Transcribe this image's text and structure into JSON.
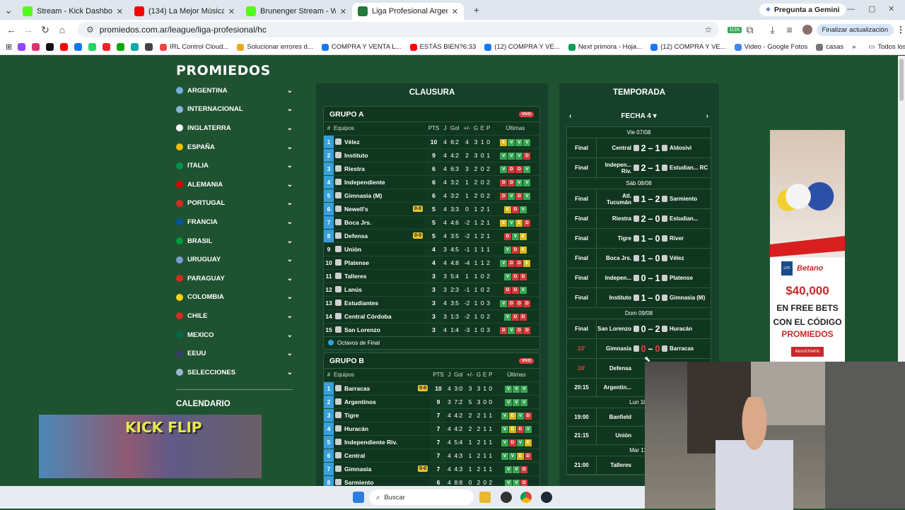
{
  "browser": {
    "tabs": [
      {
        "title": "Stream - Kick Dashboard",
        "color": "#53fc18"
      },
      {
        "title": "(134) La Mejor Música Clás",
        "color": "#ff0000"
      },
      {
        "title": "Brunenger Stream - Watch Live",
        "color": "#53fc18"
      },
      {
        "title": "Liga Profesional Argentina - PC",
        "color": "#1f7a3c"
      }
    ],
    "gemini": "Pregunta a Gemini",
    "url": "promiedos.com.ar/league/liga-profesional/hc",
    "update": "Finalizar actualización",
    "badge_count": "111K",
    "bookmarks": [
      "IRL Control Cloud...",
      "Solucionar errores d...",
      "COMPRA Y VENTA L...",
      "ESTÁS BIEN?6:33",
      "(12) COMPRA Y VE...",
      "Next primora - Hoja...",
      "(12) COMPRA Y VE...",
      "Video - Google Fotos",
      "casas"
    ],
    "all_bookmarks": "Todos los marcadores"
  },
  "site": {
    "logo": "PROMIEDOS"
  },
  "sidebar": {
    "items": [
      {
        "label": "ARGENTINA",
        "color": "#74acdf"
      },
      {
        "label": "INTERNACIONAL",
        "color": "#8fb3d9"
      },
      {
        "label": "INGLATERRA",
        "color": "#ffffff"
      },
      {
        "label": "ESPAÑA",
        "color": "#f1bf00"
      },
      {
        "label": "ITALIA",
        "color": "#009246"
      },
      {
        "label": "ALEMANIA",
        "color": "#dd0000"
      },
      {
        "label": "PORTUGAL",
        "color": "#d52b1e"
      },
      {
        "label": "FRANCIA",
        "color": "#0055a4"
      },
      {
        "label": "BRASIL",
        "color": "#009c3b"
      },
      {
        "label": "URUGUAY",
        "color": "#7b9fd4"
      },
      {
        "label": "PARAGUAY",
        "color": "#d52b1e"
      },
      {
        "label": "COLOMBIA",
        "color": "#fcd116"
      },
      {
        "label": "CHILE",
        "color": "#d52b1e"
      },
      {
        "label": "MEXICO",
        "color": "#006847"
      },
      {
        "label": "EEUU",
        "color": "#3c3b6e"
      },
      {
        "label": "SELECCIONES",
        "color": "#9bb7d4"
      }
    ],
    "calendar_title": "CALENDARIO"
  },
  "clausura": {
    "title": "CLAUSURA",
    "headers": {
      "num": "#",
      "team": "Equipos",
      "pts": "PTS",
      "j": "J",
      "gol": "Gol",
      "dif": "+/-",
      "g": "G",
      "e": "E",
      "p": "P",
      "last": "Últimas"
    },
    "live_label": "VIVO",
    "legend": "Octavos de Final",
    "group_a": {
      "name": "GRUPO A",
      "rows": [
        {
          "pos": "1",
          "team": "Vélez",
          "live": "",
          "pts": "10",
          "j": "4",
          "gol": "6:2",
          "dif": "4",
          "g": "3",
          "e": "1",
          "p": "0",
          "form": [
            "E",
            "V",
            "V",
            "V"
          ]
        },
        {
          "pos": "2",
          "team": "Instituto",
          "live": "",
          "pts": "9",
          "j": "4",
          "gol": "4:2",
          "dif": "2",
          "g": "3",
          "e": "0",
          "p": "1",
          "form": [
            "V",
            "V",
            "V",
            "D"
          ]
        },
        {
          "pos": "3",
          "team": "Riestra",
          "live": "",
          "pts": "6",
          "j": "4",
          "gol": "6:3",
          "dif": "3",
          "g": "2",
          "e": "0",
          "p": "2",
          "form": [
            "V",
            "D",
            "D",
            "V"
          ]
        },
        {
          "pos": "4",
          "team": "Independiente",
          "live": "",
          "pts": "6",
          "j": "4",
          "gol": "3:2",
          "dif": "1",
          "g": "2",
          "e": "0",
          "p": "2",
          "form": [
            "D",
            "D",
            "V",
            "V"
          ]
        },
        {
          "pos": "5",
          "team": "Gimnasia (M)",
          "live": "",
          "pts": "6",
          "j": "4",
          "gol": "3:2",
          "dif": "1",
          "g": "2",
          "e": "0",
          "p": "2",
          "form": [
            "D",
            "V",
            "D",
            "V"
          ]
        },
        {
          "pos": "6",
          "team": "Newell's",
          "live": "0-0",
          "pts": "5",
          "j": "4",
          "gol": "3:3",
          "dif": "0",
          "g": "1",
          "e": "2",
          "p": "1",
          "form": [
            "E",
            "D",
            "V"
          ]
        },
        {
          "pos": "7",
          "team": "Boca Jrs.",
          "live": "",
          "pts": "5",
          "j": "4",
          "gol": "4:6",
          "dif": "-2",
          "g": "1",
          "e": "2",
          "p": "1",
          "form": [
            "E",
            "V",
            "E",
            "D"
          ]
        },
        {
          "pos": "8",
          "team": "Defensa",
          "live": "0-0",
          "pts": "5",
          "j": "4",
          "gol": "3:5",
          "dif": "-2",
          "g": "1",
          "e": "2",
          "p": "1",
          "form": [
            "D",
            "V",
            "E"
          ]
        },
        {
          "pos": "9",
          "team": "Unión",
          "live": "",
          "pts": "4",
          "j": "3",
          "gol": "4:5",
          "dif": "-1",
          "g": "1",
          "e": "1",
          "p": "1",
          "form": [
            "V",
            "D",
            "E"
          ]
        },
        {
          "pos": "10",
          "team": "Platense",
          "live": "",
          "pts": "4",
          "j": "4",
          "gol": "4:8",
          "dif": "-4",
          "g": "1",
          "e": "1",
          "p": "2",
          "form": [
            "V",
            "D",
            "D",
            "E"
          ]
        },
        {
          "pos": "11",
          "team": "Talleres",
          "live": "",
          "pts": "3",
          "j": "3",
          "gol": "5:4",
          "dif": "1",
          "g": "1",
          "e": "0",
          "p": "2",
          "form": [
            "V",
            "D",
            "D"
          ]
        },
        {
          "pos": "12",
          "team": "Lanús",
          "live": "",
          "pts": "3",
          "j": "3",
          "gol": "2:3",
          "dif": "-1",
          "g": "1",
          "e": "0",
          "p": "2",
          "form": [
            "D",
            "D",
            "V"
          ]
        },
        {
          "pos": "13",
          "team": "Estudiantes",
          "live": "",
          "pts": "3",
          "j": "4",
          "gol": "3:5",
          "dif": "-2",
          "g": "1",
          "e": "0",
          "p": "3",
          "form": [
            "V",
            "D",
            "D",
            "D"
          ]
        },
        {
          "pos": "14",
          "team": "Central Córdoba",
          "live": "",
          "pts": "3",
          "j": "3",
          "gol": "1:3",
          "dif": "-2",
          "g": "1",
          "e": "0",
          "p": "2",
          "form": [
            "V",
            "D",
            "D"
          ]
        },
        {
          "pos": "15",
          "team": "San Lorenzo",
          "live": "",
          "pts": "3",
          "j": "4",
          "gol": "1:4",
          "dif": "-3",
          "g": "1",
          "e": "0",
          "p": "3",
          "form": [
            "D",
            "V",
            "D",
            "D"
          ]
        }
      ]
    },
    "group_b": {
      "name": "GRUPO B",
      "rows": [
        {
          "pos": "1",
          "team": "Barracas",
          "live": "0-0",
          "pts": "10",
          "j": "4",
          "gol": "3:0",
          "dif": "3",
          "g": "3",
          "e": "1",
          "p": "0",
          "form": [
            "V",
            "V",
            "V"
          ]
        },
        {
          "pos": "2",
          "team": "Argentinos",
          "live": "",
          "pts": "9",
          "j": "3",
          "gol": "7:2",
          "dif": "5",
          "g": "3",
          "e": "0",
          "p": "0",
          "form": [
            "V",
            "V",
            "V"
          ]
        },
        {
          "pos": "3",
          "team": "Tigre",
          "live": "",
          "pts": "7",
          "j": "4",
          "gol": "4:2",
          "dif": "2",
          "g": "2",
          "e": "1",
          "p": "1",
          "form": [
            "V",
            "E",
            "V",
            "D"
          ]
        },
        {
          "pos": "4",
          "team": "Huracán",
          "live": "",
          "pts": "7",
          "j": "4",
          "gol": "4:2",
          "dif": "2",
          "g": "2",
          "e": "1",
          "p": "1",
          "form": [
            "V",
            "E",
            "D",
            "V"
          ]
        },
        {
          "pos": "5",
          "team": "Independiente Riv.",
          "live": "",
          "pts": "7",
          "j": "4",
          "gol": "5:4",
          "dif": "1",
          "g": "2",
          "e": "1",
          "p": "1",
          "form": [
            "V",
            "D",
            "V",
            "E"
          ]
        },
        {
          "pos": "6",
          "team": "Central",
          "live": "",
          "pts": "7",
          "j": "4",
          "gol": "4:3",
          "dif": "1",
          "g": "2",
          "e": "1",
          "p": "1",
          "form": [
            "V",
            "V",
            "E",
            "D"
          ]
        },
        {
          "pos": "7",
          "team": "Gimnasia",
          "live": "0-0",
          "pts": "7",
          "j": "4",
          "gol": "4:3",
          "dif": "1",
          "g": "2",
          "e": "1",
          "p": "1",
          "form": [
            "V",
            "V",
            "D"
          ]
        },
        {
          "pos": "8",
          "team": "Sarmiento",
          "live": "",
          "pts": "6",
          "j": "4",
          "gol": "8:8",
          "dif": "0",
          "g": "2",
          "e": "0",
          "p": "2",
          "form": [
            "V",
            "V",
            "D"
          ]
        }
      ]
    }
  },
  "temporada": {
    "title": "TEMPORADA",
    "fecha": "FECHA 4 ▾",
    "days": [
      {
        "label": "Vie 07/08",
        "matches": [
          {
            "status": "Final",
            "home": "Central",
            "hs": "2",
            "as": "1",
            "away": "Aldosivi",
            "live": false,
            "h": 28
          },
          {
            "status": "Final",
            "home": "Indepen... Riv.",
            "hs": "2",
            "as": "1",
            "away": "Estudian... RC",
            "live": false,
            "h": 28
          }
        ]
      },
      {
        "label": "Sáb 08/08",
        "matches": [
          {
            "status": "Final",
            "home": "Atl. Tucumán",
            "hs": "1",
            "as": "2",
            "away": "Sarmiento",
            "live": false,
            "h": 28
          },
          {
            "status": "Final",
            "home": "Riestra",
            "hs": "2",
            "as": "0",
            "away": "Estudian...",
            "live": false,
            "h": 28
          },
          {
            "status": "Final",
            "home": "Tigre",
            "hs": "1",
            "as": "0",
            "away": "River",
            "live": false,
            "h": 28
          },
          {
            "status": "Final",
            "home": "Boca Jrs.",
            "hs": "1",
            "as": "0",
            "away": "Vélez",
            "live": false,
            "h": 28
          },
          {
            "status": "Final",
            "home": "Indepen...",
            "hs": "0",
            "as": "1",
            "away": "Platense",
            "live": false,
            "h": 28
          },
          {
            "status": "Final",
            "home": "Instituto",
            "hs": "1",
            "as": "0",
            "away": "Gimnasia (M)",
            "live": false,
            "h": 28
          }
        ]
      },
      {
        "label": "Dom 09/08",
        "matches": [
          {
            "status": "Final",
            "home": "San Lorenzo",
            "hs": "0",
            "as": "2",
            "away": "Huracán",
            "live": false,
            "h": 28
          },
          {
            "status": "23'",
            "home": "Gimnasia",
            "hs": "0",
            "as": "0",
            "away": "Barracas",
            "live": true,
            "h": 28
          },
          {
            "status": "24'",
            "home": "Defensa",
            "hs": "",
            "as": "",
            "away": "",
            "live": true,
            "h": 28
          },
          {
            "status": "20:15",
            "home": "Argentin...",
            "hs": "",
            "as": "",
            "away": "",
            "live": false,
            "h": 26
          }
        ]
      },
      {
        "label": "Lun 10/",
        "matches": [
          {
            "status": "19:00",
            "home": "Banfield",
            "hs": "",
            "as": "",
            "away": "",
            "live": false,
            "h": 26
          },
          {
            "status": "21:15",
            "home": "Unión",
            "hs": "",
            "as": "",
            "away": "",
            "live": false,
            "h": 26
          }
        ]
      },
      {
        "label": "Mar 11/",
        "matches": [
          {
            "status": "21:00",
            "home": "Talleres",
            "hs": "",
            "as": "",
            "away": "",
            "live": false,
            "h": 26
          }
        ]
      }
    ]
  },
  "ad": {
    "brand": "Betano",
    "league": "LPF",
    "amount": "$40,000",
    "line1": "EN FREE BETS",
    "line2": "CON EL CÓDIGO",
    "line3": "PROMIEDOS",
    "cta": "REGISTRATE"
  },
  "overlay": {
    "game_title": "KICK FLIP"
  },
  "taskbar": {
    "search": "Buscar"
  }
}
